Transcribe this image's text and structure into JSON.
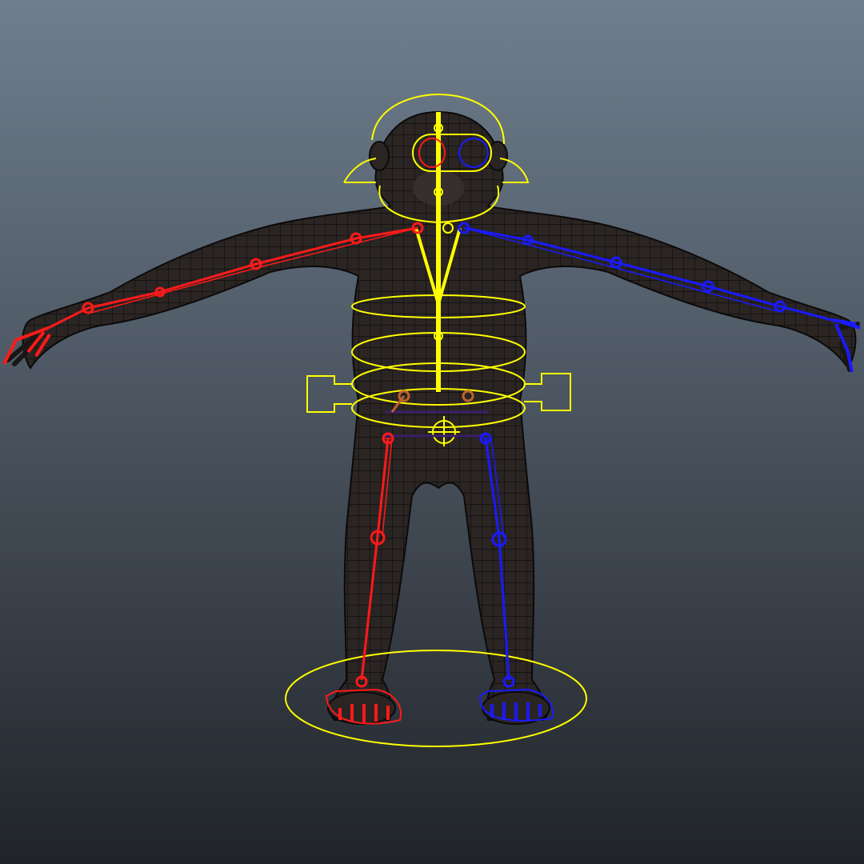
{
  "viewport": {
    "background_top": "#6f7e8e",
    "background_bottom": "#20242a"
  },
  "character": {
    "mesh_color": "#2a2523",
    "wire_color": "#0b0a0a"
  },
  "rig_colors": {
    "center_controls": "#ffff00",
    "left_side": "#ff1a1a",
    "right_side": "#1a1aff",
    "hip_joints": "#3a1f6b",
    "hip_pivot": "#c0632a"
  }
}
